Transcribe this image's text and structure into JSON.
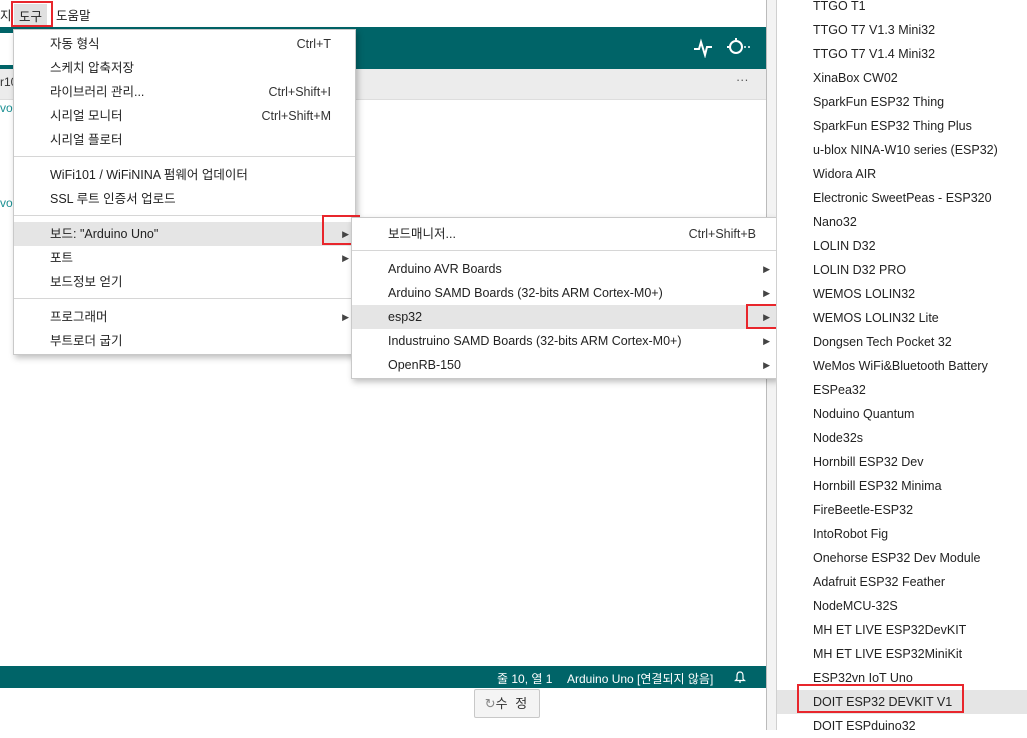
{
  "menubar": {
    "partial_left": "지",
    "tools": "도구",
    "help": "도움말"
  },
  "editor": {
    "stub1": "r10",
    "stub2": "vo.",
    "stub3": "vo."
  },
  "tools_menu": {
    "items": [
      {
        "label": "자동 형식",
        "shortcut": "Ctrl+T"
      },
      {
        "label": "스케치 압축저장",
        "shortcut": ""
      },
      {
        "label": "라이브러리 관리...",
        "shortcut": "Ctrl+Shift+I"
      },
      {
        "label": "시리얼 모니터",
        "shortcut": "Ctrl+Shift+M"
      },
      {
        "label": "시리얼 플로터",
        "shortcut": ""
      },
      {
        "label": "WiFi101 / WiFiNINA 펌웨어 업데이터",
        "shortcut": ""
      },
      {
        "label": "SSL 루트 인증서 업로드",
        "shortcut": ""
      },
      {
        "label": "보드: \"Arduino Uno\"",
        "shortcut": ""
      },
      {
        "label": "포트",
        "shortcut": ""
      },
      {
        "label": "보드정보 얻기",
        "shortcut": ""
      },
      {
        "label": "프로그래머",
        "shortcut": ""
      },
      {
        "label": "부트로더 굽기",
        "shortcut": ""
      }
    ]
  },
  "boards_menu": {
    "items": [
      {
        "label": "보드매니저...",
        "shortcut": "Ctrl+Shift+B"
      },
      {
        "label": "Arduino AVR Boards"
      },
      {
        "label": "Arduino SAMD Boards (32-bits ARM Cortex-M0+)"
      },
      {
        "label": "esp32"
      },
      {
        "label": "Industruino SAMD Boards (32-bits ARM Cortex-M0+)"
      },
      {
        "label": "OpenRB-150"
      }
    ]
  },
  "esp32_boards": [
    "TTGO T1",
    "TTGO T7 V1.3 Mini32",
    "TTGO T7 V1.4 Mini32",
    "XinaBox CW02",
    "SparkFun ESP32 Thing",
    "SparkFun ESP32 Thing Plus",
    "u-blox NINA-W10 series (ESP32)",
    "Widora AIR",
    "Electronic SweetPeas - ESP320",
    "Nano32",
    "LOLIN D32",
    "LOLIN D32 PRO",
    "WEMOS LOLIN32",
    "WEMOS LOLIN32 Lite",
    "Dongsen Tech Pocket 32",
    "WeMos WiFi&Bluetooth Battery",
    "ESPea32",
    "Noduino Quantum",
    "Node32s",
    "Hornbill ESP32 Dev",
    "Hornbill ESP32 Minima",
    "FireBeetle-ESP32",
    "IntoRobot Fig",
    "Onehorse ESP32 Dev Module",
    "Adafruit ESP32 Feather",
    "NodeMCU-32S",
    "MH ET LIVE ESP32DevKIT",
    "MH ET LIVE ESP32MiniKit",
    "ESP32vn IoT Uno",
    "DOIT ESP32 DEVKIT V1",
    "DOIT ESPduino32"
  ],
  "status": {
    "position": "줄 10, 열 1",
    "board": "Arduino Uno [연결되지 않음]"
  },
  "fix_button": "수 정",
  "tab_more": "···",
  "colors": {
    "teal": "#006468",
    "highlight_box": "#e8262c",
    "hover_row": "#e5e5e5"
  }
}
